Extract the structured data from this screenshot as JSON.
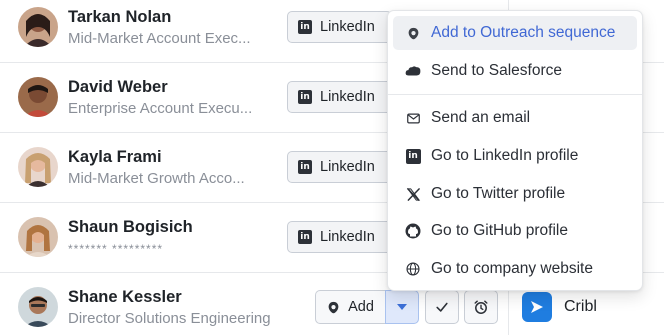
{
  "contacts": [
    {
      "name": "Tarkan Nolan",
      "title": "Mid-Market Account Exec...",
      "linkedin_label": "LinkedIn"
    },
    {
      "name": "David Weber",
      "title": "Enterprise Account Execu...",
      "linkedin_label": "LinkedIn"
    },
    {
      "name": "Kayla Frami",
      "title": "Mid-Market Growth Acco...",
      "linkedin_label": "LinkedIn"
    },
    {
      "name": "Shaun Bogisich",
      "title": "******* *********",
      "linkedin_label": "LinkedIn"
    },
    {
      "name": "Shane Kessler",
      "title": "Director Solutions Engineering",
      "add_label": "Add",
      "company": "Cribl"
    }
  ],
  "menu": {
    "items": [
      {
        "label": "Add to Outreach sequence",
        "icon": "outreach-icon"
      },
      {
        "label": "Send to Salesforce",
        "icon": "salesforce-icon"
      },
      {
        "label": "Send an email",
        "icon": "mail-icon"
      },
      {
        "label": "Go to LinkedIn profile",
        "icon": "linkedin-icon"
      },
      {
        "label": "Go to Twitter profile",
        "icon": "x-twitter-icon"
      },
      {
        "label": "Go to GitHub profile",
        "icon": "github-icon"
      },
      {
        "label": "Go to company website",
        "icon": "globe-icon"
      }
    ]
  },
  "colors": {
    "accent": "#4068d4",
    "company_logo": "#1f7de0",
    "caret_bg": "#dfe8fb"
  }
}
